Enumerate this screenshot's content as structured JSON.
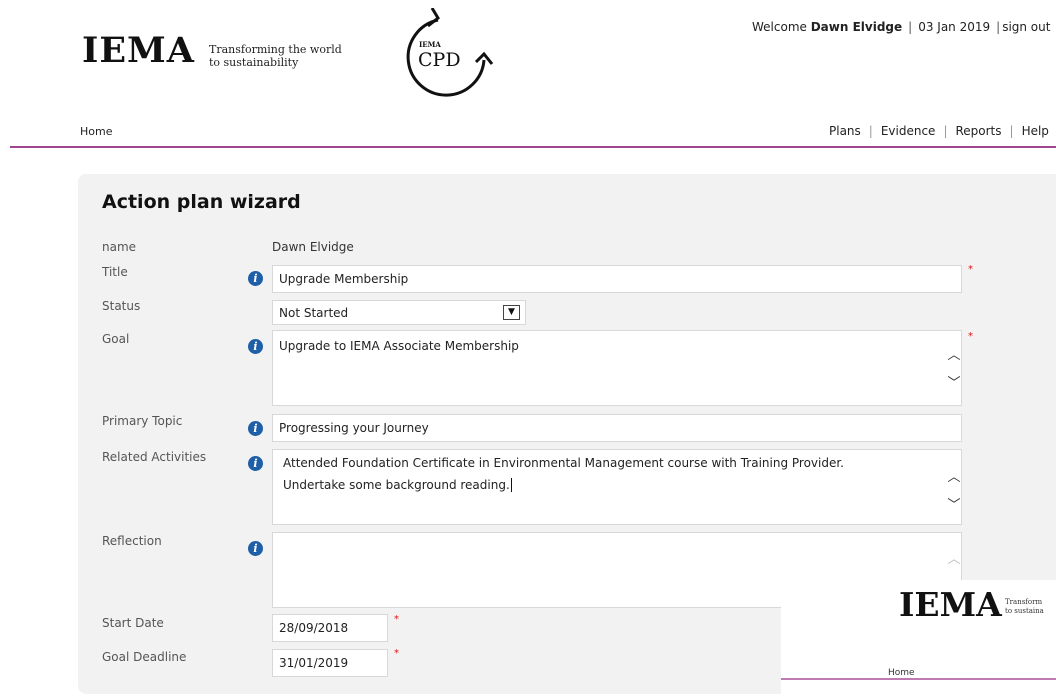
{
  "header": {
    "logo": "IEMA",
    "tagline_line1": "Transforming the world",
    "tagline_line2": "to sustainability",
    "cpd_small": "IEMA",
    "cpd_text": "CPD",
    "welcome_prefix": "Welcome",
    "user_name": "Dawn Elvidge",
    "date": "03 Jan 2019",
    "sign_out": "sign out"
  },
  "nav": {
    "home": "Home",
    "plans": "Plans",
    "evidence": "Evidence",
    "reports": "Reports",
    "help": "Help"
  },
  "form": {
    "title": "Action plan wizard",
    "name_label": "name",
    "name_value": "Dawn Elvidge",
    "title_label": "Title",
    "title_value": "Upgrade Membership",
    "status_label": "Status",
    "status_value": "Not Started",
    "goal_label": "Goal",
    "goal_value": "Upgrade to IEMA Associate Membership",
    "primary_topic_label": "Primary Topic",
    "primary_topic_value": "Progressing your Journey",
    "related_label": "Related Activities",
    "related_line1": "Attended Foundation Certificate in Environmental Management course with Training Provider.",
    "related_line2": "Undertake some background reading.",
    "reflection_label": "Reflection",
    "reflection_value": "",
    "start_label": "Start Date",
    "start_value": "28/09/2018",
    "deadline_label": "Goal Deadline",
    "deadline_value": "31/01/2019",
    "required_mark": "*"
  },
  "overlay": {
    "logo": "IEMA",
    "tagline_line1": "Transform",
    "tagline_line2": "to sustaina",
    "home": "Home"
  },
  "icons": {
    "info": "info-icon",
    "chevron_up": "chevron-up-icon",
    "chevron_down": "chevron-down-icon",
    "select_arrow": "select-arrow-icon"
  },
  "colors": {
    "accent_rule": "#a0468f",
    "info_icon": "#1f5fa8",
    "required": "#dd1111",
    "panel_bg": "#f2f2f2"
  }
}
